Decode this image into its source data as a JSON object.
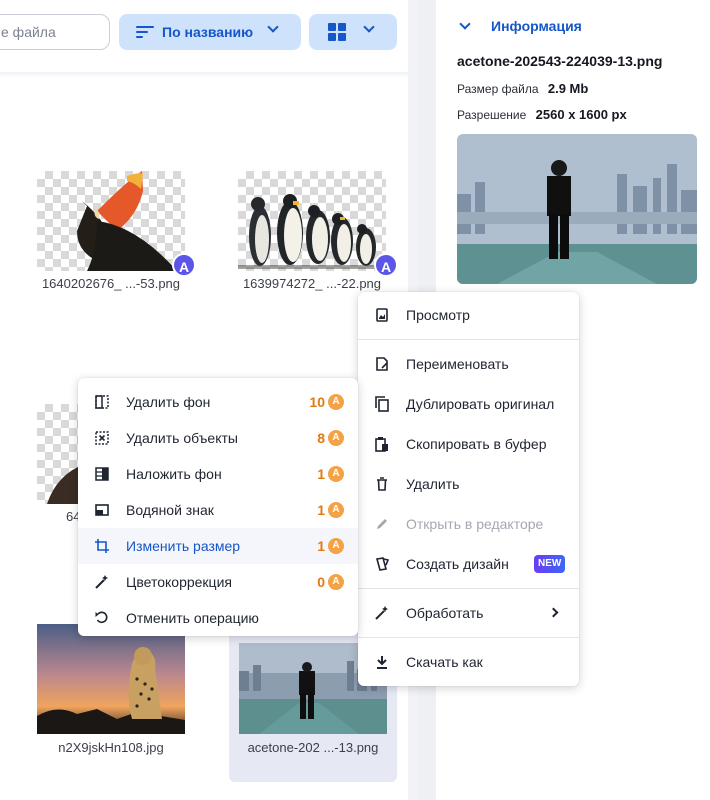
{
  "toolbar": {
    "search_placeholder": "е файла",
    "sort_label": "По названию"
  },
  "files": [
    {
      "name": "1640202676_ ...-53.png",
      "ai_badge": "A"
    },
    {
      "name": "1639974272_ ...-22.png",
      "ai_badge": "A"
    },
    {
      "name": "64"
    },
    {
      "name": "n2X9jskHn108.jpg"
    },
    {
      "name": "acetone-202 ...-13.png"
    }
  ],
  "info": {
    "title": "Информация",
    "filename": "acetone-202543-224039-13.png",
    "size_label": "Размер файла",
    "size_value": "2.9 Mb",
    "resolution_label": "Разрешение",
    "resolution_value": "2560 x 1600 px"
  },
  "context_menu": {
    "items": [
      {
        "label": "Просмотр",
        "icon": "preview-icon"
      },
      {
        "label": "Переименовать",
        "icon": "rename-icon"
      },
      {
        "label": "Дублировать оригинал",
        "icon": "duplicate-icon"
      },
      {
        "label": "Скопировать в буфер",
        "icon": "clipboard-icon"
      },
      {
        "label": "Удалить",
        "icon": "trash-icon"
      },
      {
        "label": "Открыть в редакторе",
        "icon": "pencil-icon",
        "disabled": true
      },
      {
        "label": "Создать дизайн",
        "icon": "design-icon",
        "badge": "NEW"
      },
      {
        "label": "Обработать",
        "icon": "magic-wand-icon",
        "submenu": true
      },
      {
        "label": "Скачать как",
        "icon": "download-icon"
      }
    ]
  },
  "process_menu": {
    "items": [
      {
        "label": "Удалить фон",
        "cost": "10",
        "icon": "remove-bg-icon"
      },
      {
        "label": "Удалить объекты",
        "cost": "8",
        "icon": "remove-objects-icon"
      },
      {
        "label": "Наложить фон",
        "cost": "1",
        "icon": "overlay-bg-icon"
      },
      {
        "label": "Водяной знак",
        "cost": "1",
        "icon": "watermark-icon"
      },
      {
        "label": "Изменить размер",
        "cost": "1",
        "icon": "crop-icon",
        "active": true
      },
      {
        "label": "Цветокоррекция",
        "cost": "0",
        "icon": "color-correction-icon"
      },
      {
        "label": "Отменить операцию",
        "icon": "undo-icon"
      }
    ],
    "coin_symbol": "A"
  },
  "colors": {
    "accent": "#1656c8",
    "cost": "#e07a12",
    "ai_badge": "#5b56e8"
  }
}
